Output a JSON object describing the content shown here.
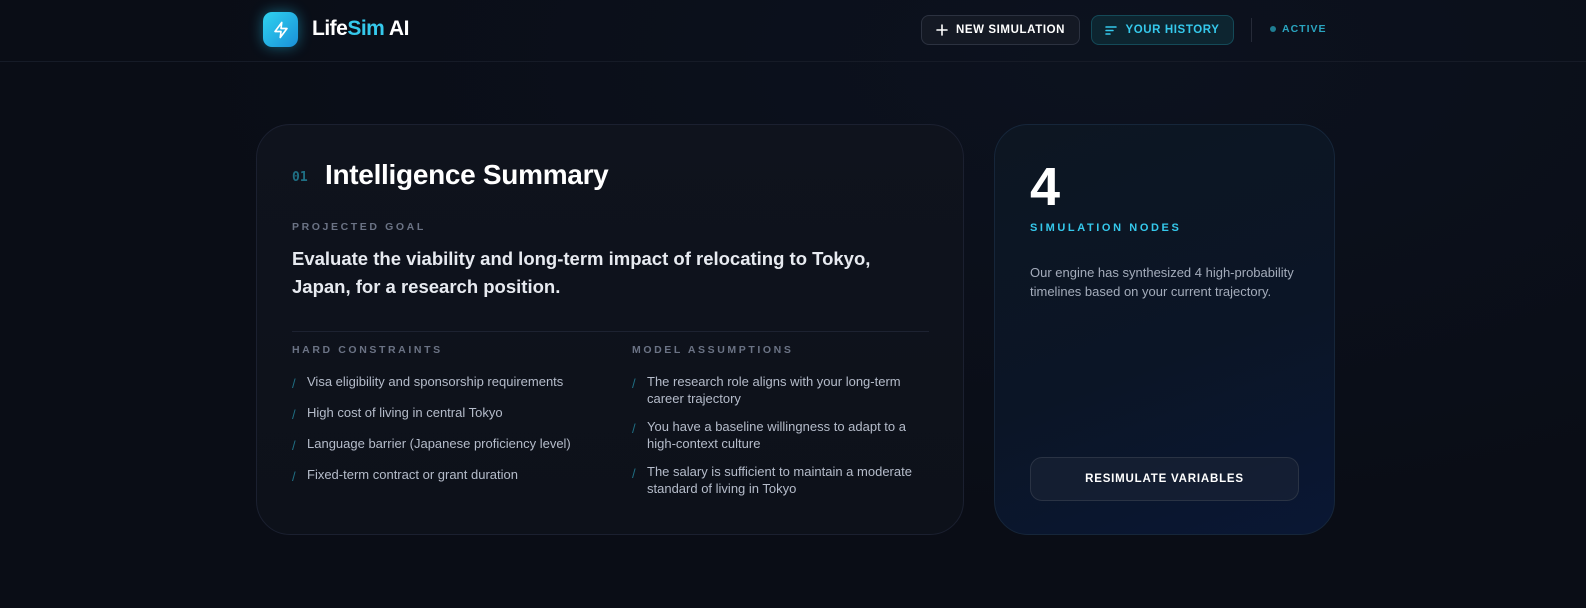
{
  "header": {
    "logo_part1": "Life",
    "logo_part2": "Sim",
    "logo_part3": " AI",
    "new_simulation_label": "NEW SIMULATION",
    "history_label": "YOUR HISTORY",
    "status_label": "ACTIVE",
    "logo_icon": "lightning-bolt-icon",
    "accent_color": "#35c9ec"
  },
  "summary": {
    "section_number": "01",
    "title": "Intelligence Summary",
    "goal_label": "PROJECTED GOAL",
    "goal_text": "Evaluate the viability and long-term impact of relocating to Tokyo, Japan, for a research position.",
    "constraints_label": "HARD CONSTRAINTS",
    "constraints": [
      "Visa eligibility and sponsorship requirements",
      "High cost of living in central Tokyo",
      "Language barrier (Japanese proficiency level)",
      "Fixed-term contract or grant duration"
    ],
    "assumptions_label": "MODEL ASSUMPTIONS",
    "assumptions": [
      "The research role aligns with your long-term career trajectory",
      "You have a baseline willingness to adapt to a high-context culture",
      "The salary is sufficient to maintain a moderate standard of living in Tokyo"
    ]
  },
  "nodes": {
    "count": "4",
    "label": "SIMULATION NODES",
    "description": "Our engine has synthesized 4 high-probability timelines based on your current trajectory.",
    "resimulate_label": "RESIMULATE VARIABLES"
  }
}
